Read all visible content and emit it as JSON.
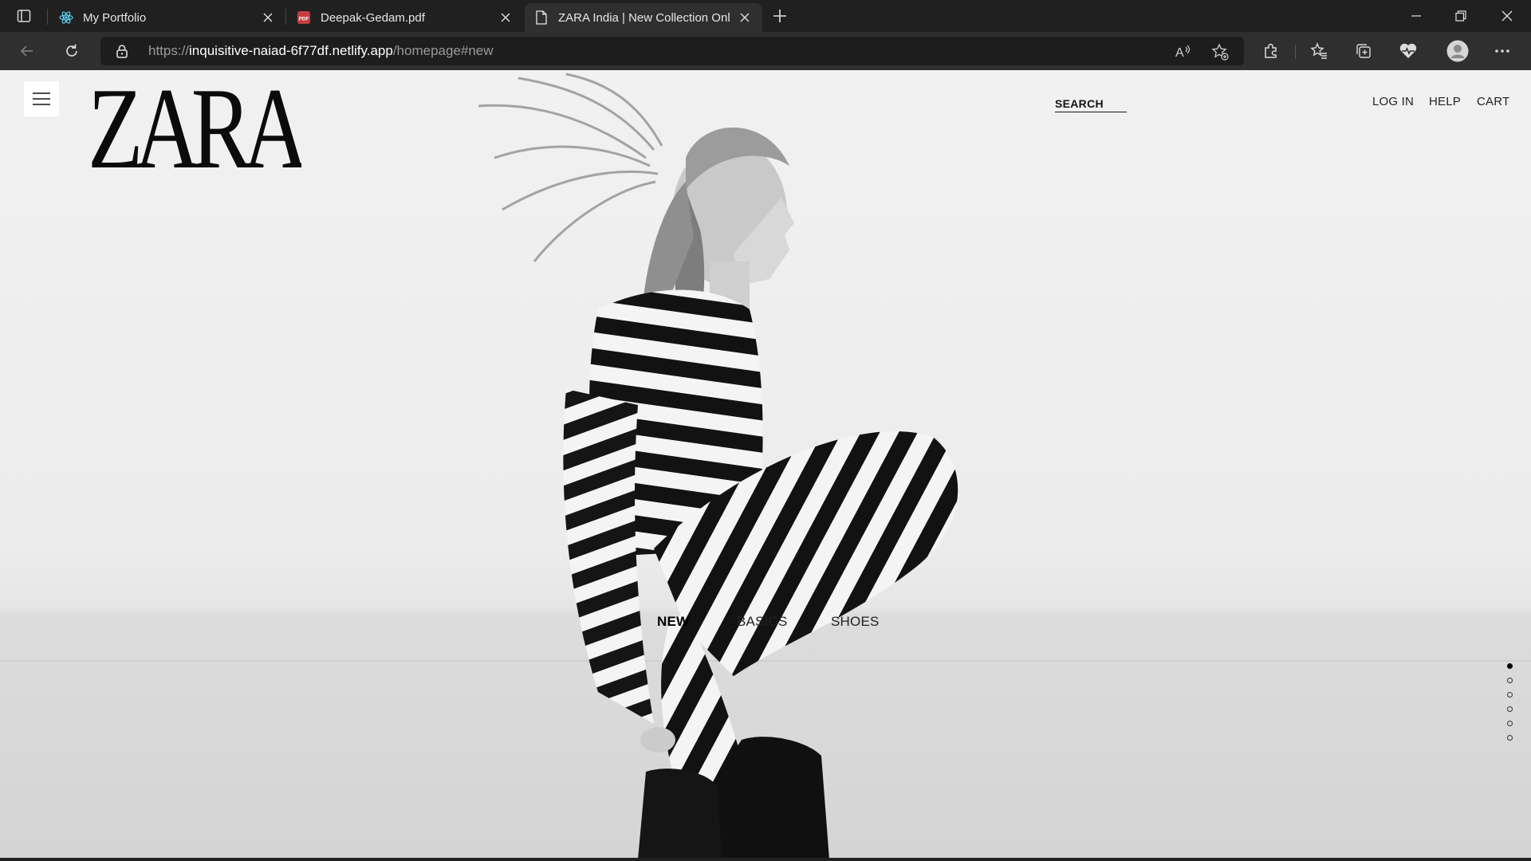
{
  "browser": {
    "tabs": [
      {
        "title": "My Portfolio",
        "icon": "react-icon",
        "active": false
      },
      {
        "title": "Deepak-Gedam.pdf",
        "icon": "pdf-icon",
        "active": false
      },
      {
        "title": "ZARA India | New Collection Onl",
        "icon": "page-icon",
        "active": true
      }
    ],
    "url": {
      "scheme": "https://",
      "host": "inquisitive-naiad-6f77df.netlify.app",
      "path": "/homepage#new"
    }
  },
  "page": {
    "logo_text": "ZARA",
    "search_label": "SEARCH",
    "top_links": [
      "LOG IN",
      "HELP",
      "CART"
    ],
    "categories": [
      {
        "label": "NEW",
        "active": true
      },
      {
        "label": "BASICS",
        "active": false
      },
      {
        "label": "SHOES",
        "active": false
      }
    ],
    "slide_dots": {
      "count": 6,
      "active_index": 0
    }
  },
  "colors": {
    "chrome_bg": "#202020",
    "toolbar_bg": "#2f2f2f",
    "page_bg": "#f1f1f1",
    "text": "#111111"
  }
}
